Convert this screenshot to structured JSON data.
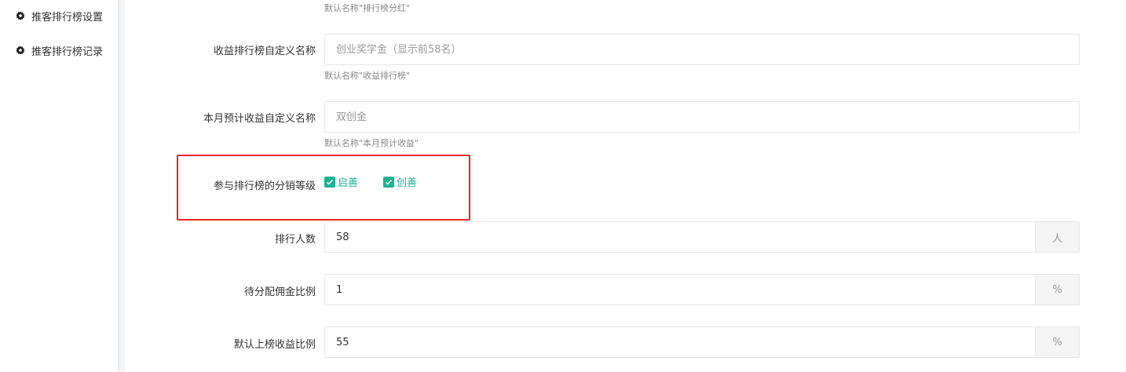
{
  "sidebar": {
    "items": [
      {
        "label": "推客排行榜设置",
        "icon": "gear-icon"
      },
      {
        "label": "推客排行榜记录",
        "icon": "gear-icon"
      }
    ]
  },
  "form": {
    "top_hint": "默认名称\"排行榜分红\"",
    "earnings_name": {
      "label": "收益排行榜自定义名称",
      "value": "",
      "placeholder": "创业奖学金（显示前58名）",
      "hint": "默认名称\"收益排行榜\""
    },
    "monthly_name": {
      "label": "本月预计收益自定义名称",
      "value": "",
      "placeholder": "双创金",
      "hint": "默认名称\"本月预计收益\""
    },
    "levels": {
      "label": "参与排行榜的分销等级",
      "options": [
        {
          "label": "启善",
          "checked": true
        },
        {
          "label": "创善",
          "checked": true
        }
      ]
    },
    "rank_count": {
      "label": "排行人数",
      "value": "58",
      "addon": "人"
    },
    "pending_ratio": {
      "label": "待分配佣金比例",
      "value": "1",
      "addon": "%"
    },
    "default_ratio": {
      "label": "默认上榜收益比例",
      "value": "55",
      "addon": "%"
    }
  },
  "colors": {
    "accent": "#1ab394",
    "highlight": "#e8261f"
  }
}
